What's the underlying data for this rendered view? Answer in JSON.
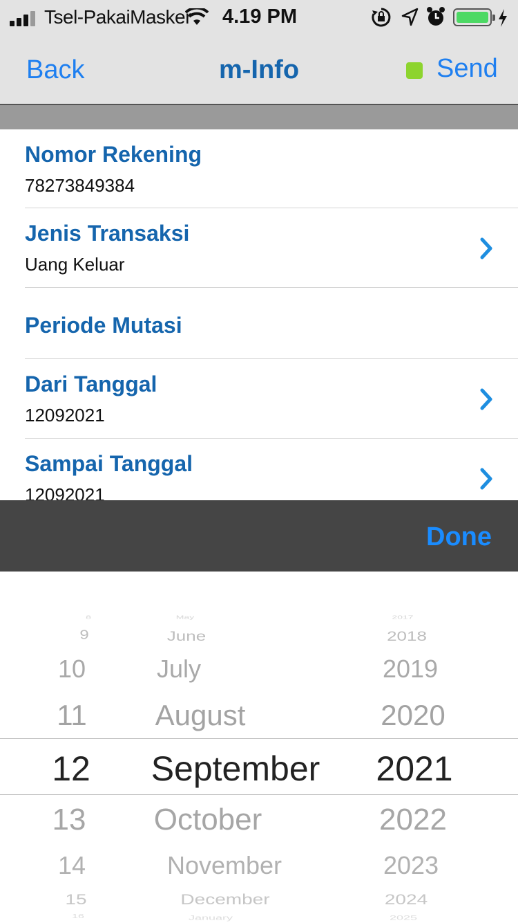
{
  "status_bar": {
    "carrier": "Tsel-PakaiMasker",
    "time": "4.19 PM"
  },
  "nav": {
    "back_label": "Back",
    "title": "m-Info",
    "send_label": "Send",
    "send_indicator_color": "#8dd42e"
  },
  "form": {
    "rows": [
      {
        "label": "Nomor Rekening",
        "value": "78273849384"
      },
      {
        "label": "Jenis Transaksi",
        "value": "Uang Keluar"
      },
      {
        "label": "Periode Mutasi"
      },
      {
        "label": "Dari Tanggal",
        "value": "12092021"
      },
      {
        "label": "Sampai Tanggal",
        "value": "12092021"
      }
    ]
  },
  "toolbar": {
    "done_label": "Done"
  },
  "picker": {
    "days": [
      "8",
      "9",
      "10",
      "11",
      "12",
      "13",
      "14",
      "15",
      "16"
    ],
    "months": [
      "May",
      "June",
      "July",
      "August",
      "September",
      "October",
      "November",
      "December",
      "January"
    ],
    "years": [
      "2017",
      "2018",
      "2019",
      "2020",
      "2021",
      "2022",
      "2023",
      "2024",
      "2025"
    ],
    "selected": {
      "day": "12",
      "month": "September",
      "year": "2021"
    }
  },
  "colors": {
    "accent_blue": "#1e7ff0",
    "label_blue": "#1565ad",
    "chevron_blue": "#1e8ee0"
  }
}
